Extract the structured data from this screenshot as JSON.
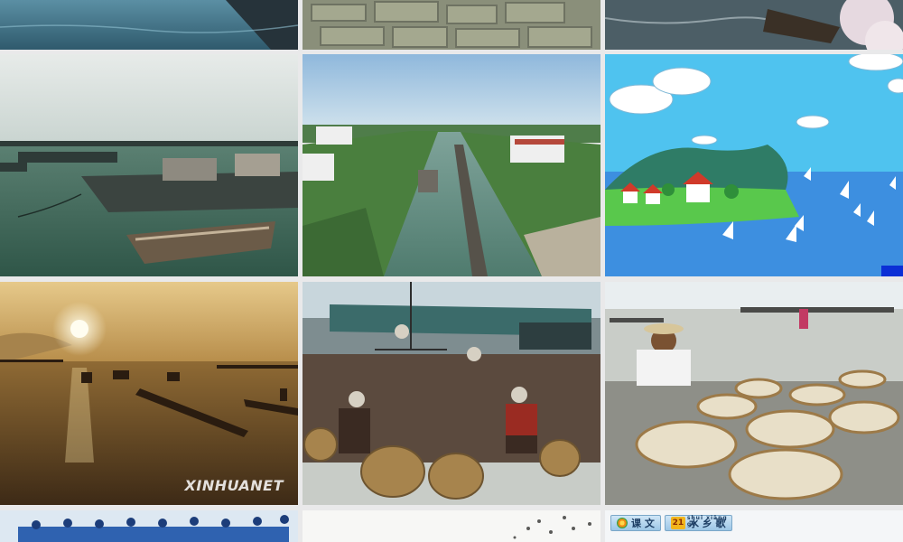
{
  "tiles": {
    "fishing_sunrise": {
      "watermark": "XINHUANET"
    },
    "lesson_banner": {
      "section_label": "课 文",
      "lesson_number": "21",
      "lesson_title": "水 乡 歌",
      "lesson_pinyin": "shuǐ xiāng gē"
    }
  },
  "colors": {
    "background": "#e9e9ea",
    "sky_blue": "#4fc3ef",
    "water_teal": "#3c6e5e",
    "sunset_gold": "#c99a3c"
  }
}
